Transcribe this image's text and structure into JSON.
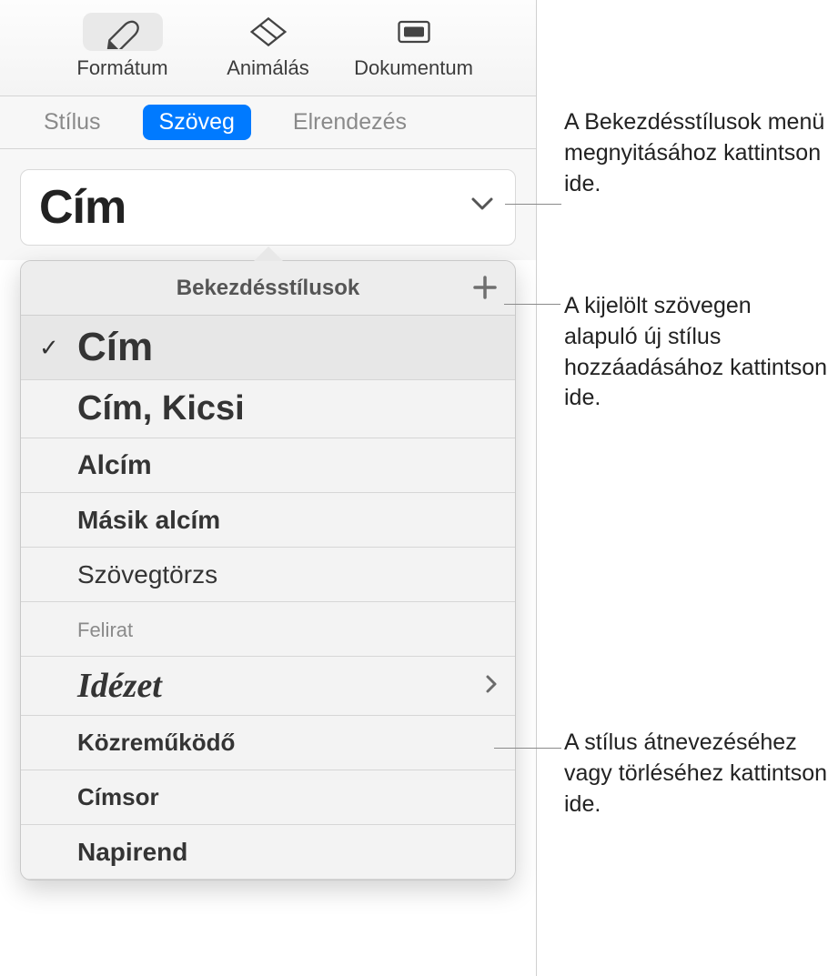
{
  "toolbar": {
    "format": "Formátum",
    "animate": "Animálás",
    "document": "Dokumentum"
  },
  "subtabs": {
    "style": "Stílus",
    "text": "Szöveg",
    "layout": "Elrendezés"
  },
  "current_style_name": "Cím",
  "popover": {
    "title": "Bekezdésstílusok",
    "items": [
      {
        "label": "Cím",
        "class": "si-title",
        "checked": true
      },
      {
        "label": "Cím, Kicsi",
        "class": "si-title-sm"
      },
      {
        "label": "Alcím",
        "class": "si-subtitle"
      },
      {
        "label": "Másik alcím",
        "class": "si-subtitle2"
      },
      {
        "label": "Szövegtörzs",
        "class": "si-body"
      },
      {
        "label": "Felirat",
        "class": "si-caption"
      },
      {
        "label": "Idézet",
        "class": "si-quote",
        "arrow": true
      },
      {
        "label": "Közreműködő",
        "class": "si-credit"
      },
      {
        "label": "Címsor",
        "class": "si-heading"
      },
      {
        "label": "Napirend",
        "class": "si-agenda"
      }
    ]
  },
  "callouts": {
    "open_menu": "A Bekezdésstílusok menü megnyitásához kattintson ide.",
    "add_style": "A kijelölt szövegen alapuló új stílus hozzáadásához kattintson ide.",
    "rename_del": "A stílus átnevezéséhez vagy törléséhez kattintson ide."
  }
}
